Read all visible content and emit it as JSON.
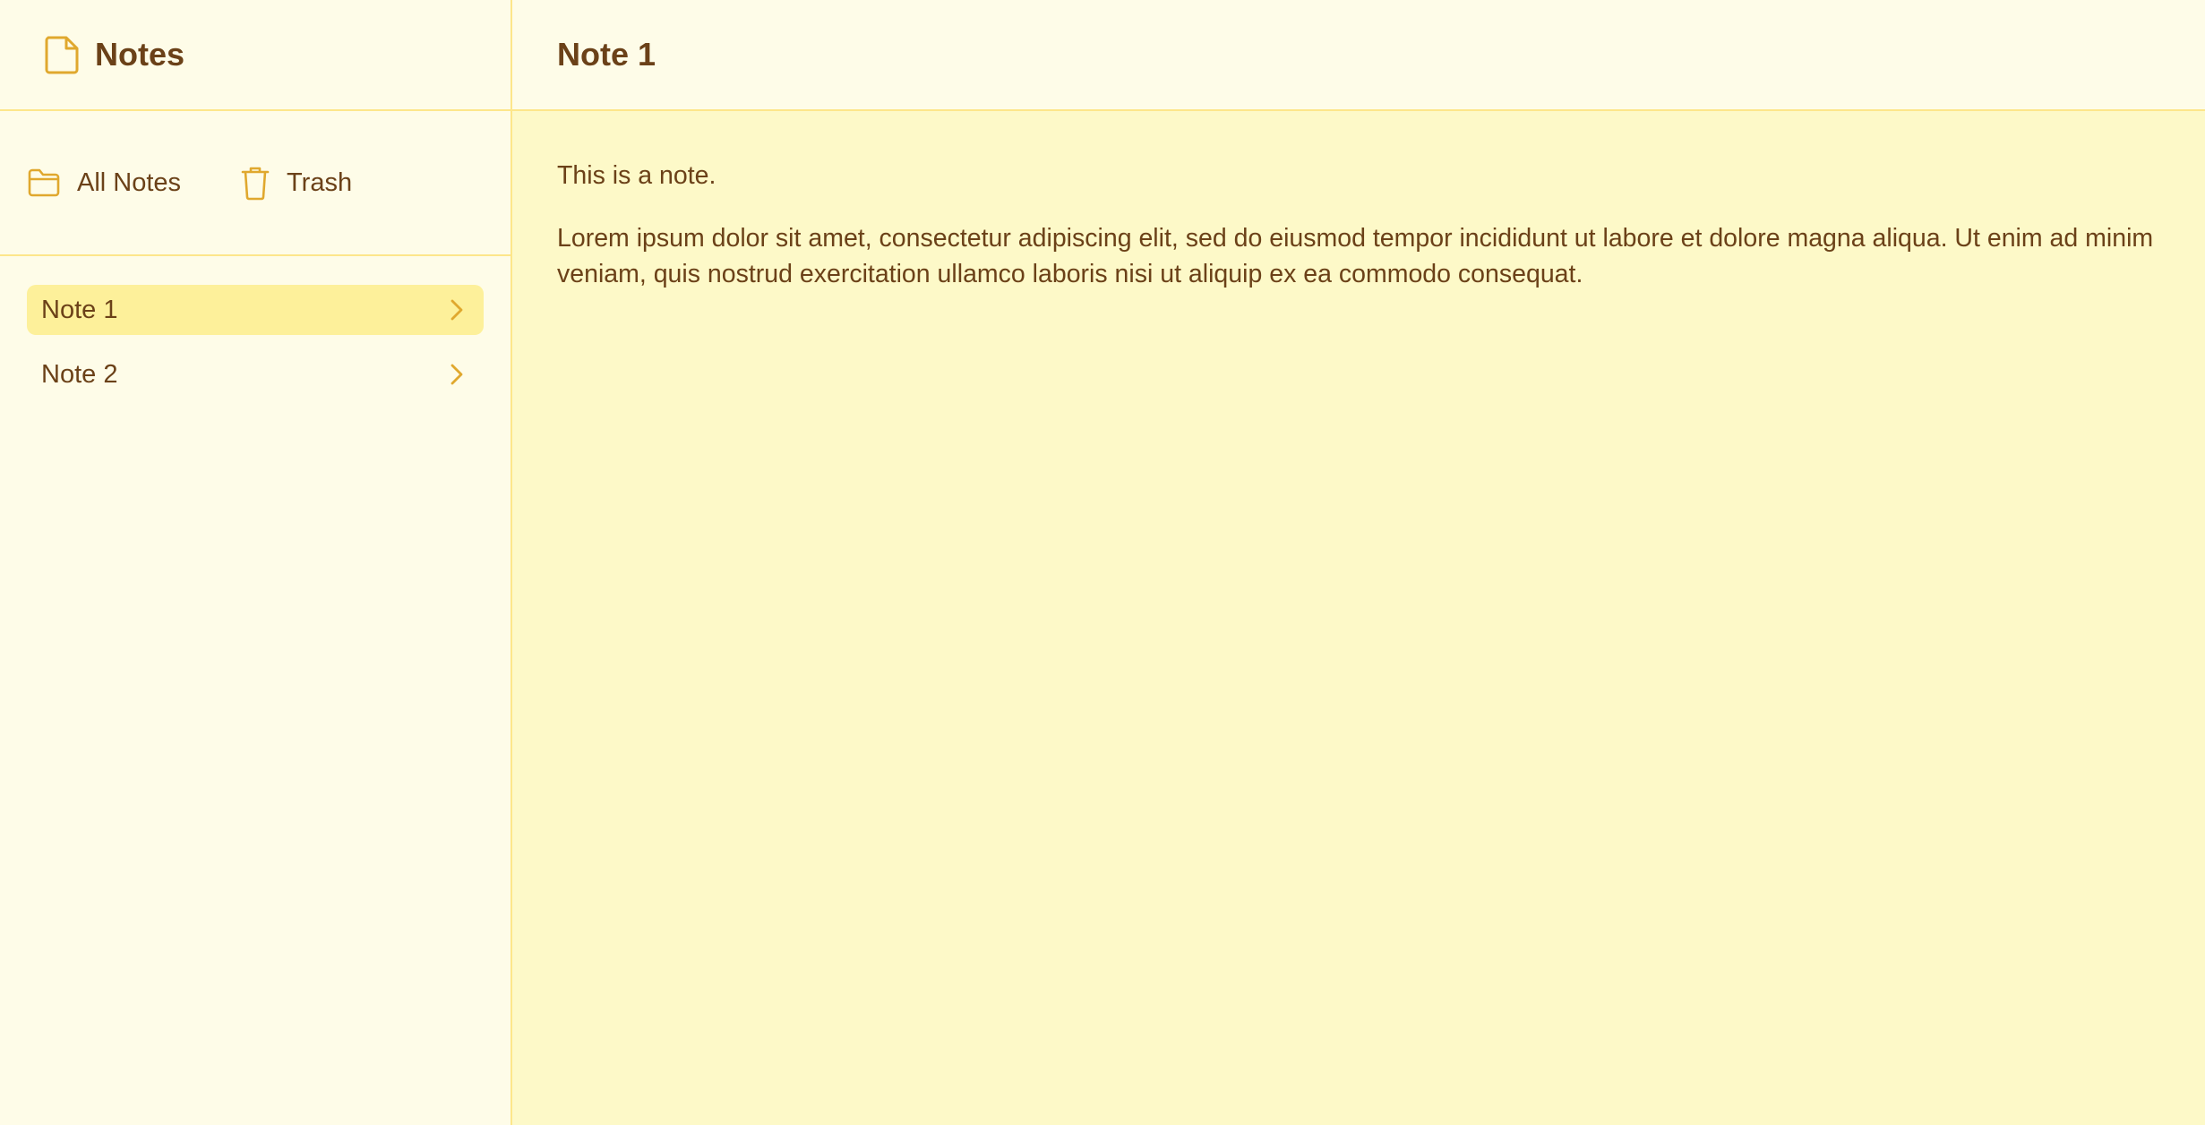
{
  "app": {
    "title": "Notes",
    "icon": "document-icon"
  },
  "folders": [
    {
      "label": "All Notes",
      "icon": "folder-icon"
    },
    {
      "label": "Trash",
      "icon": "trash-icon"
    }
  ],
  "notes": [
    {
      "label": "Note 1",
      "selected": true
    },
    {
      "label": "Note 2",
      "selected": false
    }
  ],
  "main": {
    "title": "Note 1",
    "paragraphs": [
      "This is a note.",
      "Lorem ipsum dolor sit amet, consectetur adipiscing elit, sed do eiusmod tempor incididunt ut labore et dolore magna aliqua. Ut enim ad minim veniam, quis nostrud exercitation ullamco laboris nisi ut aliquip ex ea commodo consequat."
    ]
  },
  "colors": {
    "accent": "#e0a82e",
    "text": "#6b4118",
    "sidebar_bg": "#fefce8",
    "body_bg": "#fdf9c8",
    "selected_bg": "#fdf09a",
    "border": "#fde68a"
  }
}
